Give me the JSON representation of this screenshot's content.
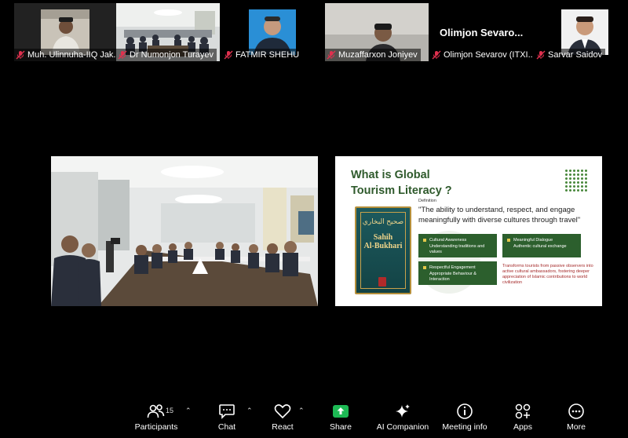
{
  "participants": [
    {
      "name": "Muh. Ulinnuha-IIQ Jak...",
      "muted": true
    },
    {
      "name": "Dr Numonjon Turayev",
      "muted": true,
      "active_speaker": true
    },
    {
      "name": "FATMIR SHEHU",
      "muted": true
    },
    {
      "name": "Muzaffarxon Joniyev",
      "muted": true
    },
    {
      "name": "Olimjon Sevarov (ITXI...",
      "muted": true,
      "display_title": "Olimjon Sevaro..."
    },
    {
      "name": "Sarvar Saidov",
      "muted": true
    }
  ],
  "slide": {
    "title_line1": "What is Global",
    "title_line2": "Tourism Literacy ?",
    "definition_label": "Definition",
    "definition": "\"The ability to understand, respect, and engage meaningfully with diverse cultures through travel\"",
    "book_title_line1": "Sahih",
    "book_title_line2": "Al-Bukhari",
    "book_arabic": "صحيح البخاري",
    "boxes": [
      "Cultural Awareness\nUnderstanding traditions and values",
      "Meaningful Dialogue\nAuthentic cultural exchange",
      "Respectful Engagement\nAppropriate Behaviour & Interaction"
    ],
    "transform_text": "Transforms tourists from passive observers into active cultural ambassadors, fostering deeper appreciation of Islamic contributions to world civilization"
  },
  "toolbar": {
    "participants_label": "Participants",
    "participants_count": "15",
    "chat_label": "Chat",
    "react_label": "React",
    "share_label": "Share",
    "ai_label": "AI Companion",
    "meeting_info_label": "Meeting info",
    "apps_label": "Apps",
    "more_label": "More"
  },
  "colors": {
    "active_border": "#2ecf5a",
    "mic_muted": "#e0304e",
    "share_green": "#1db954",
    "slide_green": "#2c5f2d"
  }
}
